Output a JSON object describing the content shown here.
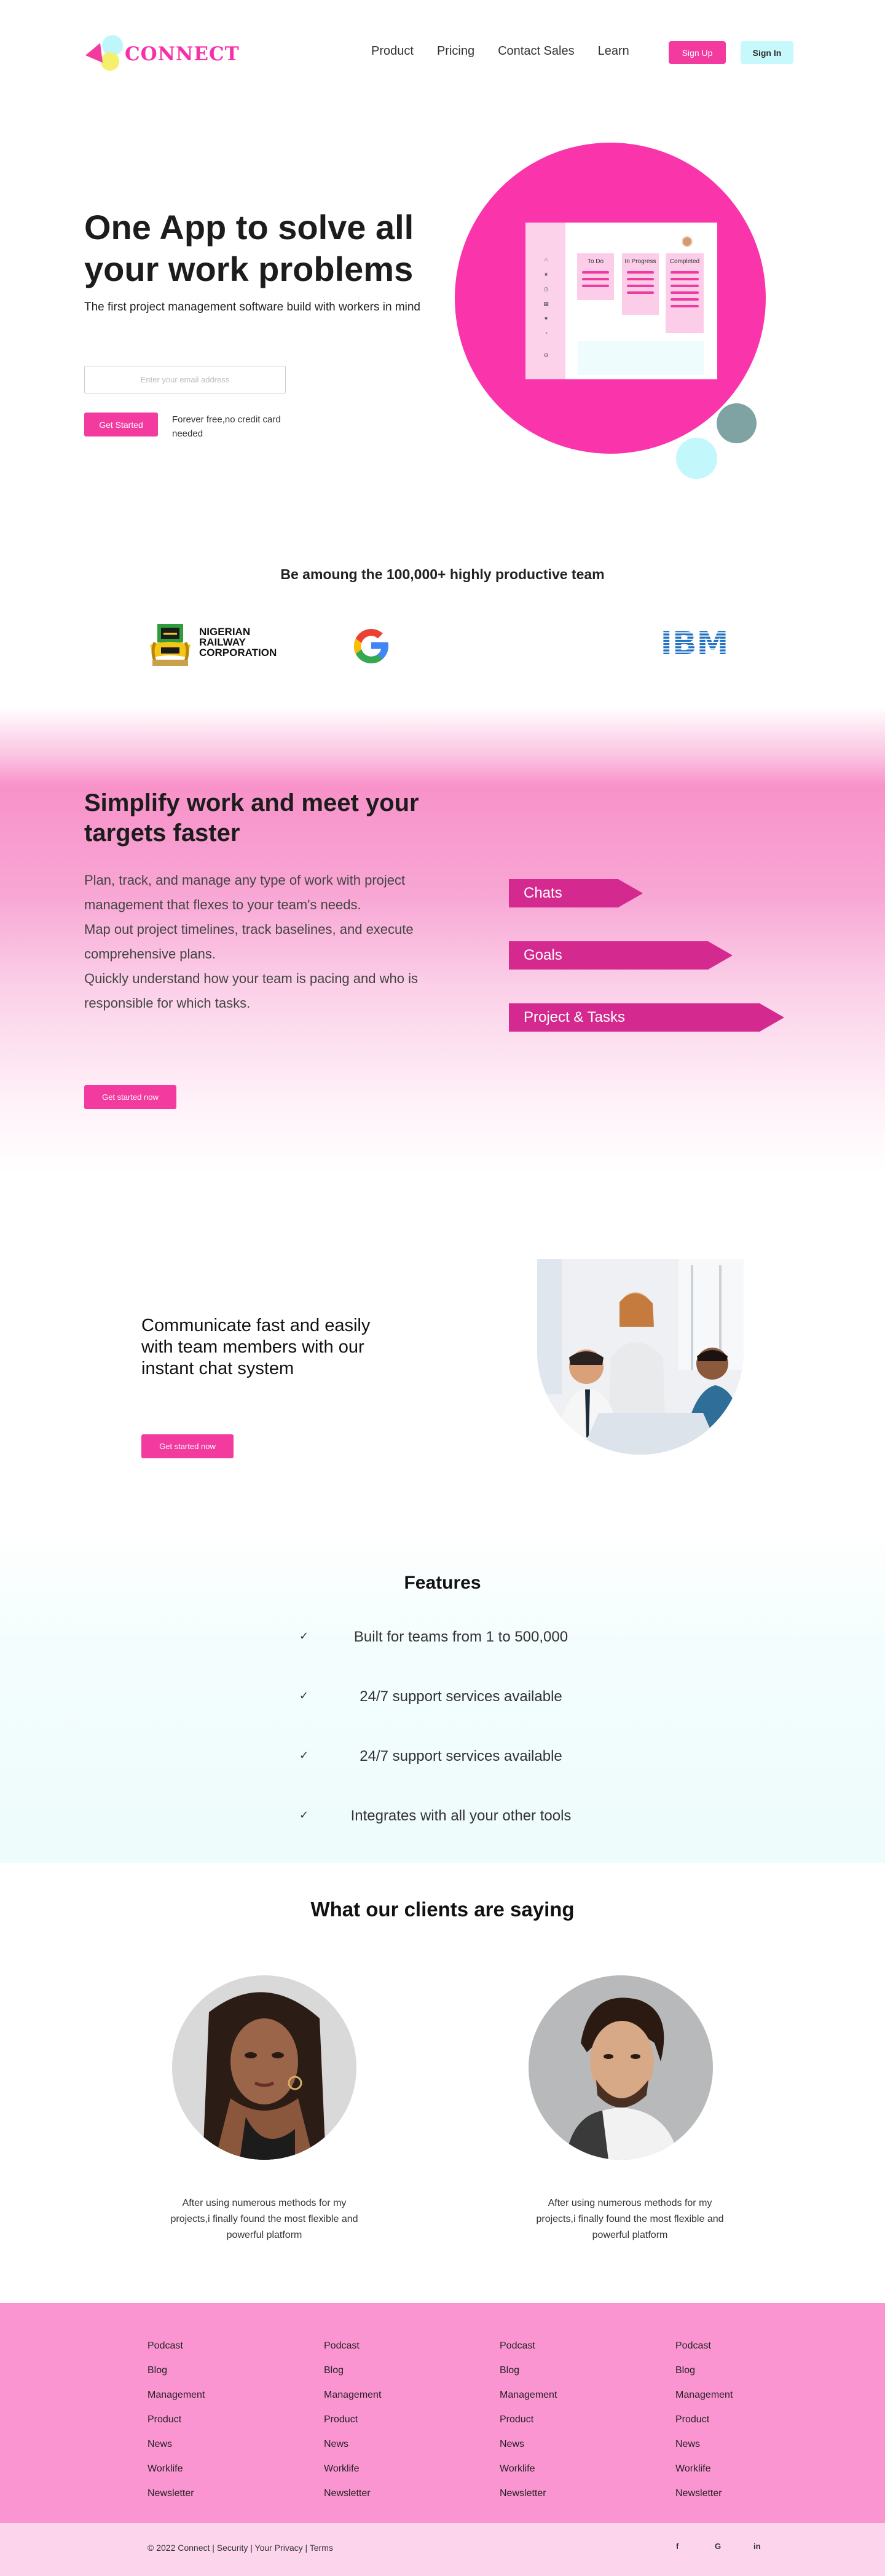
{
  "header": {
    "logo_text": "CONNECT",
    "nav": [
      "Product",
      "Pricing",
      "Contact Sales",
      "Learn"
    ],
    "signup_label": "Sign Up",
    "signin_label": "Sign In"
  },
  "hero": {
    "title": "One App to solve all your work problems",
    "subtitle": "The first project management software build with workers in mind",
    "email_placeholder": "Enter your email address",
    "cta_label": "Get Started",
    "note": "Forever free,no credit card needed",
    "board": {
      "columns": [
        "To Do",
        "In Progress",
        "Completed"
      ],
      "sidebar_icons": [
        "home-icon",
        "star-icon",
        "clock-icon",
        "grid-icon",
        "heart-icon",
        "bell-icon",
        "settings-icon"
      ]
    }
  },
  "team": {
    "title": "Be amoung the 100,000+ highly productive team",
    "logos": [
      "nigerian-railway-corporation-logo",
      "google-logo",
      "ibm-logo"
    ],
    "nrc_text": [
      "NIGERIAN",
      "RAILWAY",
      "CORPORATION"
    ],
    "ibm_text": "IBM"
  },
  "simplify": {
    "title": "Simplify work and meet your targets faster",
    "body": [
      "Plan, track, and manage any type of work with project management that flexes to your team's needs.",
      "Map out project timelines, track baselines, and execute comprehensive plans.",
      "Quickly understand how your team is pacing and who is responsible for which tasks."
    ],
    "cta_label": "Get started now",
    "tags": [
      "Chats",
      "Goals",
      "Project & Tasks"
    ]
  },
  "communicate": {
    "text": "Communicate fast and easily with team members with our instant chat system",
    "cta_label": "Get started now"
  },
  "features": {
    "title": "Features",
    "items": [
      "Built for teams from 1 to 500,000",
      "24/7 support services available",
      "24/7 support services available",
      "Integrates with all your other tools"
    ]
  },
  "clients": {
    "title": "What our clients are saying",
    "testimonials": [
      "After using numerous methods for my projects,i finally found the most flexible and powerful platform",
      "After using numerous methods for my projects,i finally found the most flexible and powerful platform"
    ]
  },
  "footer": {
    "columns": [
      [
        "Podcast",
        "Blog",
        "Management",
        "Product",
        "News",
        "Worklife",
        "Newsletter"
      ],
      [
        "Podcast",
        "Blog",
        "Management",
        "Product",
        "News",
        "Worklife",
        "Newsletter"
      ],
      [
        "Podcast",
        "Blog",
        "Management",
        "Product",
        "News",
        "Worklife",
        "Newsletter"
      ],
      [
        "Podcast",
        "Blog",
        "Management",
        "Product",
        "News",
        "Worklife",
        "Newsletter"
      ]
    ],
    "copyright": "© 2022 Connect | Security | Your Privacy | Terms",
    "social": [
      "f",
      "G",
      "in"
    ]
  },
  "colors": {
    "brand_pink": "#f23a9f",
    "hero_circle": "#fa34aa",
    "tag_pink": "#d42a8f",
    "footer_pink": "#fb95d2",
    "light_cyan": "#c7f8fb"
  }
}
